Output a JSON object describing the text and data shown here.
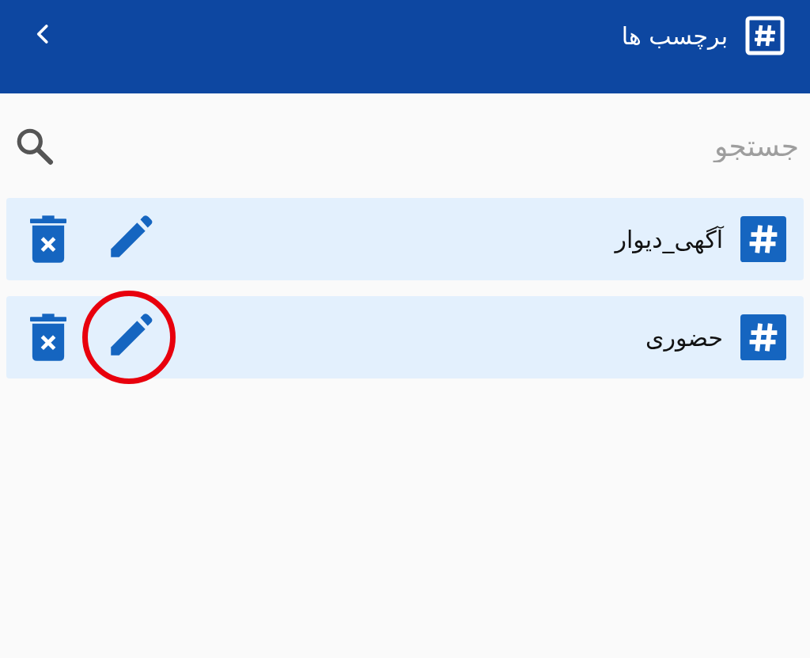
{
  "app_bar": {
    "title": "برچسب ها"
  },
  "search": {
    "placeholder": "جستجو"
  },
  "tags": [
    {
      "name": "آگهی_دیوار",
      "highlighted": false
    },
    {
      "name": "حضوری",
      "highlighted": true
    }
  ]
}
